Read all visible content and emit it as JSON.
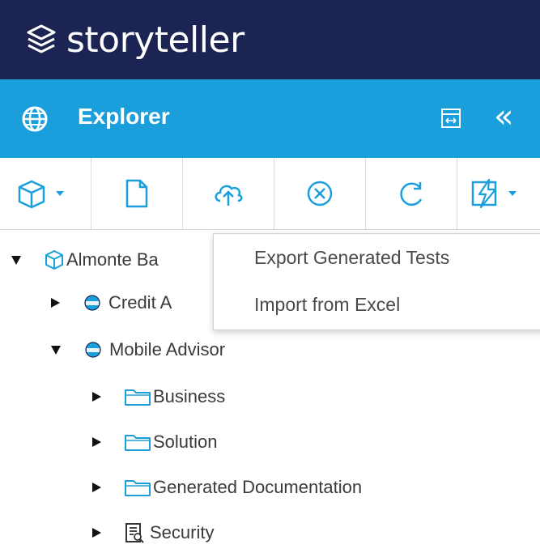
{
  "app": {
    "brand": "storyteller"
  },
  "panel": {
    "title": "Explorer",
    "collapse_glyph": "«"
  },
  "toolbar": {
    "buttons": [
      {
        "icon": "cube-dropdown-icon"
      },
      {
        "icon": "new-document-icon"
      },
      {
        "icon": "cloud-upload-icon"
      },
      {
        "icon": "cancel-circle-icon"
      },
      {
        "icon": "refresh-icon"
      },
      {
        "icon": "lightning-edit-dropdown-icon"
      }
    ]
  },
  "context_menu": {
    "items": [
      {
        "label": "Export Generated Tests"
      },
      {
        "label": "Import from Excel"
      }
    ]
  },
  "tree": {
    "nodes": [
      {
        "label": "Almonte Ba",
        "expanded": true,
        "icon": "cube-icon",
        "level": 0
      },
      {
        "label": "Credit A",
        "expanded": false,
        "icon": "app-badge-icon",
        "level": 1
      },
      {
        "label": "Mobile Advisor",
        "expanded": true,
        "icon": "app-badge-icon",
        "level": 1
      },
      {
        "label": "Business",
        "expanded": false,
        "icon": "folder-icon",
        "level": 2
      },
      {
        "label": "Solution",
        "expanded": false,
        "icon": "folder-icon",
        "level": 2
      },
      {
        "label": "Generated Documentation",
        "expanded": false,
        "icon": "folder-icon",
        "level": 2
      },
      {
        "label": "Security",
        "expanded": false,
        "icon": "security-doc-icon",
        "level": 2
      }
    ]
  },
  "colors": {
    "topbar": "#1b2452",
    "panel_header": "#1b9fdc",
    "icon_blue": "#1b9fdc"
  }
}
